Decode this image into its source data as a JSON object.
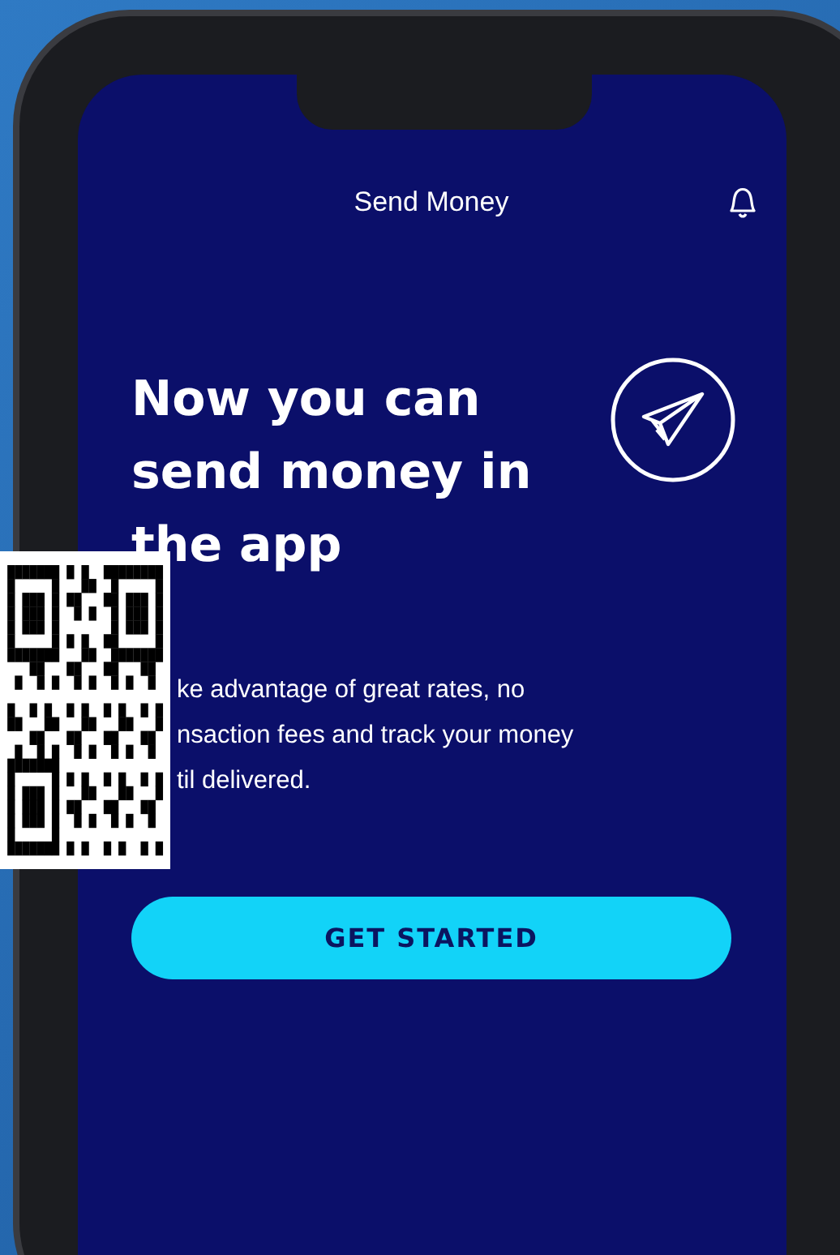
{
  "header": {
    "title": "Send Money"
  },
  "hero": {
    "heading": "Now you can send money in the app"
  },
  "body_lines": [
    "ke advantage of great rates, no",
    "nsaction fees and track your money",
    "til delivered."
  ],
  "button": {
    "label": "GET STARTED"
  }
}
